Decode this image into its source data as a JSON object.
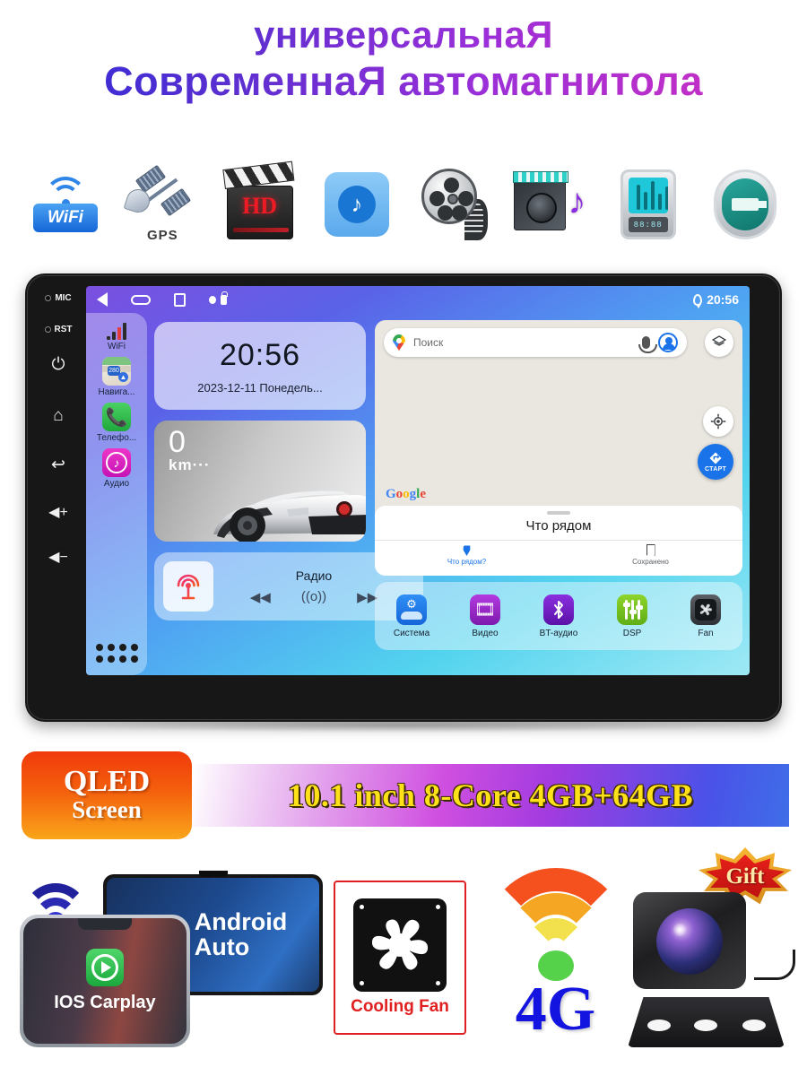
{
  "title": {
    "line1": "универсальнаЯ",
    "line2": "СовременнаЯ автомагнитола"
  },
  "features": [
    {
      "id": "wifi-icon",
      "label": "WiFi"
    },
    {
      "id": "gps-icon",
      "label": "GPS"
    },
    {
      "id": "hd-video-icon",
      "label": "HD"
    },
    {
      "id": "music-icon",
      "label": ""
    },
    {
      "id": "film-reel-icon",
      "label": ""
    },
    {
      "id": "media-player-icon",
      "label": ""
    },
    {
      "id": "equalizer-icon",
      "label": "88:88"
    },
    {
      "id": "usb-icon",
      "label": ""
    }
  ],
  "head_unit": {
    "bezel": [
      {
        "name": "mic-hole",
        "label": "MIC"
      },
      {
        "name": "reset-hole",
        "label": "RST"
      },
      {
        "name": "power-button",
        "glyph": "⏻"
      },
      {
        "name": "home-button",
        "glyph": "⌂"
      },
      {
        "name": "back-button",
        "glyph": "↩"
      },
      {
        "name": "volume-up-button",
        "glyph": "🔊"
      },
      {
        "name": "volume-down-button",
        "glyph": "🔉"
      }
    ],
    "statusbar": {
      "time": "20:56"
    },
    "sidebar": [
      {
        "label": "WiFi",
        "icon": "signal-bars-icon"
      },
      {
        "label": "Навига...",
        "icon": "navigation-icon"
      },
      {
        "label": "Телефо...",
        "icon": "phone-icon"
      },
      {
        "label": "Аудио",
        "icon": "music-icon"
      }
    ],
    "clock_widget": {
      "time": "20:56",
      "date": "2023-12-11   Понедель..."
    },
    "car_widget": {
      "speed": "0",
      "unit": "km···"
    },
    "radio_widget": {
      "name": "Радио",
      "prev": "◀◀",
      "tune": "((o))",
      "next": "▶▶"
    },
    "maps": {
      "search_placeholder": "Поиск",
      "start_label": "СТАРТ",
      "watermark": "Google",
      "sheet_title": "Что рядом",
      "tabs": [
        {
          "label": "Что рядом?",
          "icon": "map-pin-icon"
        },
        {
          "label": "Сохранено",
          "icon": "bookmark-icon"
        }
      ]
    },
    "dock": [
      {
        "label": "Система",
        "icon": "system-car-icon"
      },
      {
        "label": "Видео",
        "icon": "video-icon"
      },
      {
        "label": "BT-аудио",
        "icon": "bluetooth-icon"
      },
      {
        "label": "DSP",
        "icon": "dsp-sliders-icon"
      },
      {
        "label": "Fan",
        "icon": "fan-icon"
      }
    ]
  },
  "qled_badge": {
    "line1": "QLED",
    "line2": "Screen"
  },
  "spec_bar": {
    "text": "10.1 inch 8-Core 4GB+64GB"
  },
  "bottom": {
    "android_auto": {
      "line1": "Android",
      "line2": "Auto"
    },
    "carplay": {
      "label": "IOS Carplay"
    },
    "cooling_fan": {
      "label": "Cooling Fan"
    },
    "network": {
      "label": "4G"
    },
    "gift_badge": {
      "label": "Gift"
    }
  },
  "colors": {
    "title_start": "#2b2bd8",
    "title_end": "#d12fbe",
    "qled_orange": "#f4600d",
    "spec_text_yellow": "#ffe11a",
    "fan_red": "#e02020",
    "network_blue": "#1414e0",
    "maps_blue": "#1a73e8"
  }
}
